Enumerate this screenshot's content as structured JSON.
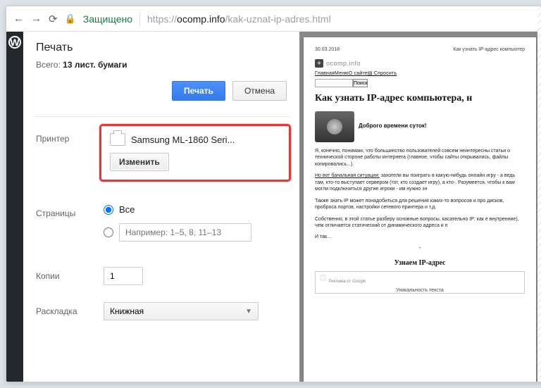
{
  "address": {
    "secure_label": "Защищено",
    "proto": "https://",
    "host": "ocomp.info",
    "path": "/kak-uznat-ip-adres.html"
  },
  "print": {
    "title": "Печать",
    "total_prefix": "Всего: ",
    "total_bold": "13 лист. бумаги",
    "print_btn": "Печать",
    "cancel_btn": "Отмена",
    "printer_label": "Принтер",
    "printer_name": "Samsung ML-1860 Seri...",
    "change_btn": "Изменить",
    "pages_label": "Страницы",
    "pages_all": "Все",
    "pages_range_placeholder": "Например: 1–5, 8, 11–13",
    "copies_label": "Копии",
    "copies_value": "1",
    "layout_label": "Раскладка",
    "layout_value": "Книжная"
  },
  "preview": {
    "date": "30.03.2018",
    "header_right": "Как узнать IP-адрес компьютер",
    "logo_text": "ocomp.info",
    "nav": "ГлавнаяМенюО сайте▤ Спросить",
    "search_btn": "Поиск",
    "h1": "Как узнать IP-адрес компьютера, н",
    "greet": "Доброго времени суток!",
    "p1": "Я, конечно, понимаю, что большинство пользователей совсем неинтересны статьи о технической стороне работы интернета (главное, чтобы сайты открывались, файлы копировались...).",
    "p2_u": "Но вот банальная ситуация:",
    "p2": " захотели вы поиграть в какую-нибудь онлайн игру - а ведь там, кто-то выступает сервером (тот, кто создает игру), а кто-. Разумеется, чтобы к вам могли подключиться другие игроки - им нужно зн",
    "p3": "Также знать IP может понадобиться для решения каких-то вопросов и про дисков, проброса портов, настройки сетевого принтера и т.д.",
    "p4": "Собственно, в этой статье разберу основные вопросы, касательно IP: как е внутренние), чем отличается статический от динамического адреса и п",
    "p5": "И так...",
    "h2": "Узнаем IP-адрес",
    "ad_label": "Реклама от Google",
    "ad_center": "Уникальность текста"
  }
}
